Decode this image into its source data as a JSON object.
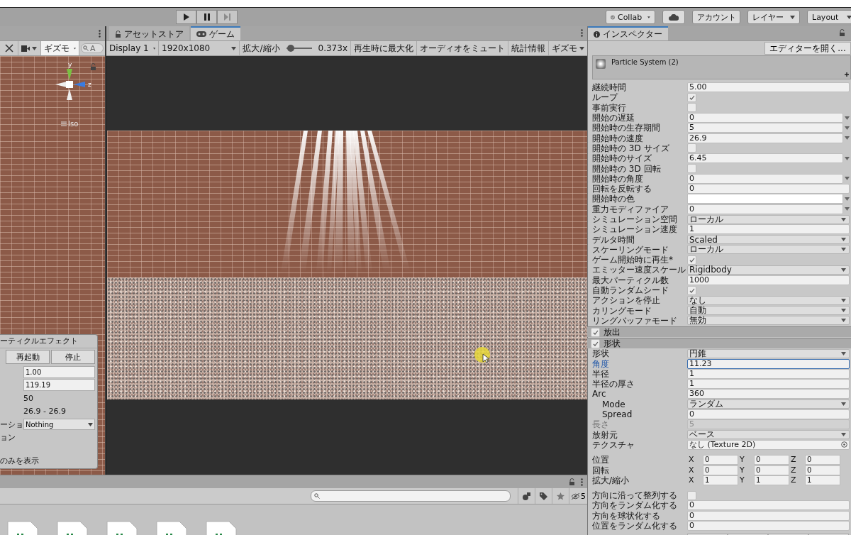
{
  "toolbar": {
    "play_buttons": [
      {
        "kind": "play",
        "disabled": false
      },
      {
        "kind": "pause",
        "disabled": false
      },
      {
        "kind": "step",
        "disabled": true
      }
    ],
    "collab": "Collab",
    "account": "アカウント",
    "layers": "レイヤー",
    "layout": "Layout"
  },
  "scene": {
    "gizmos": "ギズモ",
    "search_placeholder": "A",
    "axis_y": "y",
    "axis_z": "z",
    "projection": "Iso",
    "overlay": {
      "title": "ーティクルエフェクト",
      "buttons": [
        "再起動",
        "停止"
      ],
      "rows": [
        {
          "kind": "field",
          "value": "1.00"
        },
        {
          "kind": "field",
          "value": "119.19"
        },
        {
          "kind": "text",
          "value": "50"
        },
        {
          "kind": "text",
          "value": "26.9 - 26.9"
        },
        {
          "kind": "dropdown",
          "label": "ーショ",
          "value": "Nothing"
        },
        {
          "kind": "label",
          "label": "ョン"
        },
        {
          "kind": "label",
          "label": "のみを表示",
          "spaced": true
        }
      ]
    }
  },
  "game": {
    "tabs": [
      {
        "label": "アセットストア",
        "selected": false
      },
      {
        "label": "ゲーム",
        "selected": true
      }
    ],
    "display": "Display 1",
    "resolution": "1920x1080",
    "scale_label": "拡大/縮小",
    "scale": {
      "level": 0.05
    },
    "scale_value": "0.373x",
    "toggles": [
      "再生時に最大化",
      "オーディオをミュート",
      "統計情報"
    ],
    "gizmos": "ギズモ"
  },
  "project": {
    "hidden_count": "5"
  },
  "inspector": {
    "tabs": [
      {
        "label": "インスペクター",
        "selected": true
      }
    ],
    "open_editor": "エディターを開く...",
    "component": "Particle System (2)",
    "rows": [
      {
        "kind": "field",
        "label": "継続時間",
        "value": "5.00"
      },
      {
        "kind": "check",
        "label": "ループ",
        "checked": true
      },
      {
        "kind": "check",
        "label": "事前実行",
        "checked": false
      },
      {
        "kind": "curve",
        "label": "開始の遅延",
        "value": "0"
      },
      {
        "kind": "curve",
        "label": "開始時の生存期間",
        "value": "5"
      },
      {
        "kind": "curve",
        "label": "開始時の速度",
        "value": "26.9"
      },
      {
        "kind": "check",
        "label": "開始時の 3D サイズ",
        "checked": false
      },
      {
        "kind": "curve",
        "label": "開始時のサイズ",
        "value": "6.45"
      },
      {
        "kind": "check",
        "label": "開始時の 3D 回転",
        "checked": false
      },
      {
        "kind": "curve",
        "label": "開始時の角度",
        "value": "0"
      },
      {
        "kind": "field",
        "label": "回転を反転する",
        "value": "0"
      },
      {
        "kind": "color",
        "label": "開始時の色",
        "color": "#ffffff"
      },
      {
        "kind": "curve",
        "label": "重力モディファイア",
        "value": "0"
      },
      {
        "kind": "dropdown",
        "label": "シミュレーション空間",
        "value": "ローカル"
      },
      {
        "kind": "field",
        "label": "シミュレーション速度",
        "value": "1"
      },
      {
        "kind": "dropdown",
        "label": "デルタ時間",
        "value": "Scaled"
      },
      {
        "kind": "dropdown",
        "label": "スケーリングモード",
        "value": "ローカル"
      },
      {
        "kind": "check",
        "label": "ゲーム開始時に再生*",
        "checked": true
      },
      {
        "kind": "dropdown",
        "label": "エミッター速度スケール",
        "value": "Rigidbody"
      },
      {
        "kind": "field",
        "label": "最大パーティクル数",
        "value": "1000"
      },
      {
        "kind": "check",
        "label": "自動ランダムシード",
        "checked": true
      },
      {
        "kind": "dropdown",
        "label": "アクションを停止",
        "value": "なし"
      },
      {
        "kind": "dropdown",
        "label": "カリングモード",
        "value": "自動"
      },
      {
        "kind": "dropdown",
        "label": "リングバッファモード",
        "value": "無効"
      },
      {
        "kind": "section",
        "label": "放出",
        "checked": true
      },
      {
        "kind": "section",
        "label": "形状",
        "checked": true
      },
      {
        "kind": "dropdown",
        "label": "形状",
        "value": "円錐"
      },
      {
        "kind": "field",
        "label": "角度",
        "value": "11.23",
        "focused": true
      },
      {
        "kind": "field",
        "label": "半径",
        "value": "1"
      },
      {
        "kind": "field",
        "label": "半径の厚さ",
        "value": "1"
      },
      {
        "kind": "field",
        "label": "Arc",
        "value": "360",
        "children": [
          {
            "kind": "dropdown",
            "label": "Mode",
            "value": "ランダム"
          },
          {
            "kind": "field",
            "label": "Spread",
            "value": "0"
          }
        ]
      },
      {
        "kind": "field",
        "label": "長さ",
        "value": "5",
        "disabled": true
      },
      {
        "kind": "dropdown",
        "label": "放射元",
        "value": "ベース"
      },
      {
        "kind": "object",
        "label": "テクスチャ",
        "value": "なし (Texture 2D)"
      },
      {
        "kind": "vec3",
        "label": "位置",
        "fields": [
          {
            "axis": "X",
            "value": "0"
          },
          {
            "axis": "Y",
            "value": "0"
          },
          {
            "axis": "Z",
            "value": "0"
          }
        ],
        "spaced": true
      },
      {
        "kind": "vec3",
        "label": "回転",
        "fields": [
          {
            "axis": "X",
            "value": "0"
          },
          {
            "axis": "Y",
            "value": "0"
          },
          {
            "axis": "Z",
            "value": "0"
          }
        ]
      },
      {
        "kind": "vec3",
        "label": "拡大/縮小",
        "fields": [
          {
            "axis": "X",
            "value": "1"
          },
          {
            "axis": "Y",
            "value": "1"
          },
          {
            "axis": "Z",
            "value": "1"
          }
        ]
      },
      {
        "kind": "check",
        "label": "方向に沿って整列する",
        "checked": false,
        "spaced": true
      },
      {
        "kind": "field",
        "label": "方向をランダム化する",
        "value": "0"
      },
      {
        "kind": "field",
        "label": "方向を球状化する",
        "value": "0"
      },
      {
        "kind": "field",
        "label": "位置をランダム化する",
        "value": "0"
      }
    ]
  }
}
